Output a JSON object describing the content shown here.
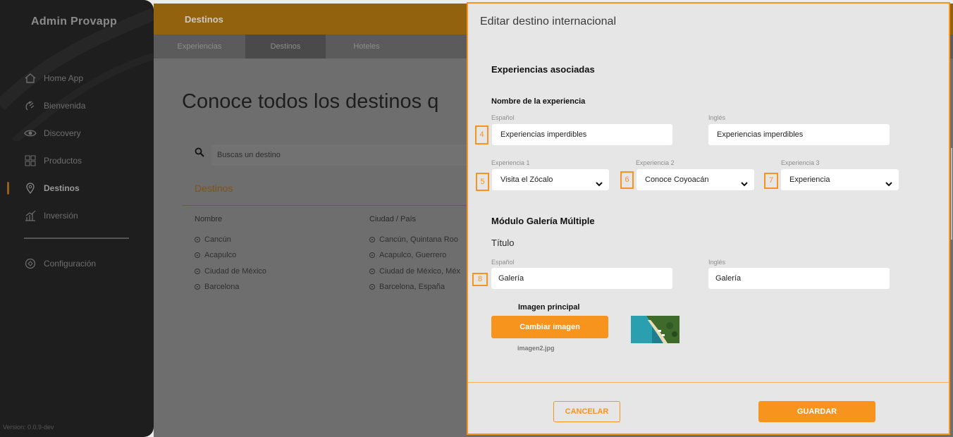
{
  "sidebar": {
    "brand": "Admin Provapp",
    "items": [
      {
        "label": "Home App",
        "icon": "home-icon"
      },
      {
        "label": "Bienvenida",
        "icon": "waving-hand-icon"
      },
      {
        "label": "Discovery",
        "icon": "eye-icon"
      },
      {
        "label": "Productos",
        "icon": "grid-icon"
      },
      {
        "label": "Destinos",
        "icon": "map-pin-icon",
        "active": true
      },
      {
        "label": "Inversión",
        "icon": "bar-chart-icon"
      }
    ],
    "settings": {
      "label": "Configuración",
      "icon": "settings-icon"
    },
    "version": "Version: 0.0.9-dev"
  },
  "topbar": {
    "title": "Destinos"
  },
  "tabs": [
    {
      "label": "Experiencias"
    },
    {
      "label": "Destinos",
      "active": true
    },
    {
      "label": "Hoteles"
    }
  ],
  "page": {
    "headline": "Conoce todos los destinos q",
    "search_placeholder": "Buscas un destino",
    "section_title": "Destinos",
    "columns": [
      "Nombre",
      "Ciudad / País"
    ],
    "rows": [
      {
        "name": "Cancún",
        "city": "Cancún, Quintana Roo"
      },
      {
        "name": "Acapulco",
        "city": "Acapulco, Guerrero"
      },
      {
        "name": "Ciudad de México",
        "city": "Ciudad de México, Méx"
      },
      {
        "name": "Barcelona",
        "city": "Barcelona, España"
      }
    ]
  },
  "modal": {
    "title": "Editar destino internacional",
    "experiences": {
      "heading": "Experiencias asociadas",
      "name_label": "Nombre de la experiencia",
      "es_label": "Español",
      "en_label": "Inglés",
      "es_value": "Experiencias imperdibles",
      "en_value": "Experiencias imperdibles",
      "exp1_label": "Experiencia 1",
      "exp2_label": "Experiencia 2",
      "exp3_label": "Experiencia 3",
      "exp1_value": "Visita el Zócalo",
      "exp2_value": "Conoce Coyoacán",
      "exp3_value": "Experiencia"
    },
    "gallery": {
      "heading": "Módulo Galería Múltiple",
      "title_label": "Título",
      "es_label": "Español",
      "en_label": "Inglés",
      "es_value": "Galería",
      "en_value": "Galería",
      "image_label": "Imagen principal",
      "change_button": "Cambiar imagen",
      "filename": "imagen2.jpg"
    },
    "badges": [
      "4",
      "5",
      "6",
      "7",
      "8"
    ],
    "cancel_button": "CANCELAR",
    "save_button": "GUARDAR"
  },
  "colors": {
    "accent": "#f7941d",
    "sidebar": "#1e1e1e",
    "modal_bg": "#e6e6e6"
  }
}
